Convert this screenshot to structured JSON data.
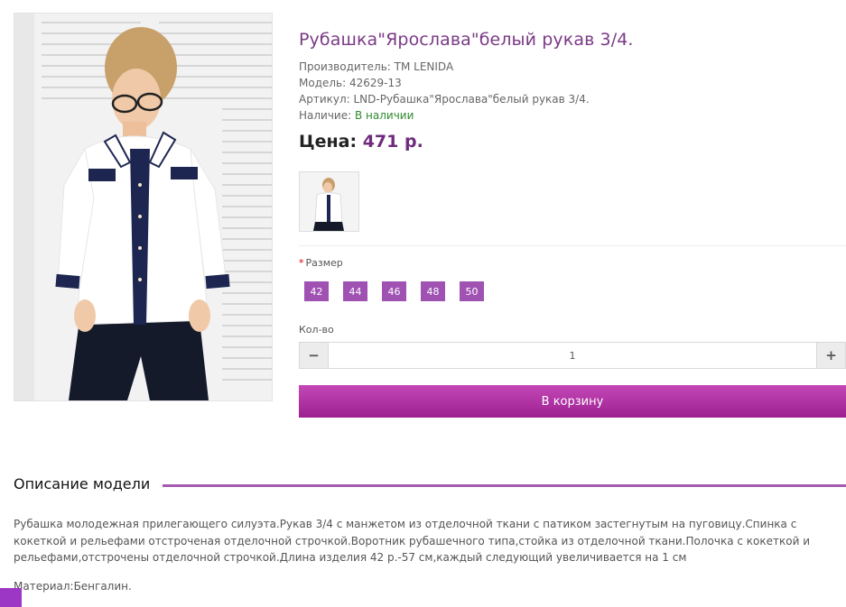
{
  "product": {
    "title": "Рубашка\"Ярослава\"белый рукав 3/4.",
    "manufacturer": "Производитель: TM LENIDA",
    "model": "Модель: 42629-13",
    "sku": "Артикул: LND-Рубашка\"Ярослава\"белый рукав 3/4.",
    "availability_label": "Наличие: ",
    "availability_value": "В наличии",
    "price_label": "Цена:",
    "price_value": "471 р."
  },
  "options": {
    "required_mark": "*",
    "size_label": "Размер",
    "sizes": [
      "42",
      "44",
      "46",
      "48",
      "50"
    ]
  },
  "quantity": {
    "label": "Кол-во",
    "value": "1",
    "minus": "−",
    "plus": "+"
  },
  "cart": {
    "button_label": "В корзину"
  },
  "description": {
    "heading": "Описание модели",
    "text": "Рубашка молодежная прилегающего силуэта.Рукав 3/4 с манжетом из отделочной ткани с патиком застегнутым на пуговицу.Спинка с кокеткой и рельефами отстроченая отделочной строчкой.Воротник рубашечного типа,стойка из отделочной ткани.Полочка с кокеткой и рельефами,отстрочены отделочной строчкой.Длина изделия 42 р.-57 см,каждый следующий увеличивается на 1 см",
    "material": "Материал:Бенгалин."
  },
  "colors": {
    "accent": "#7b3a86",
    "size_button": "#a052b3",
    "cart_button": "#b03aa6",
    "in_stock": "#2e8b2e"
  }
}
